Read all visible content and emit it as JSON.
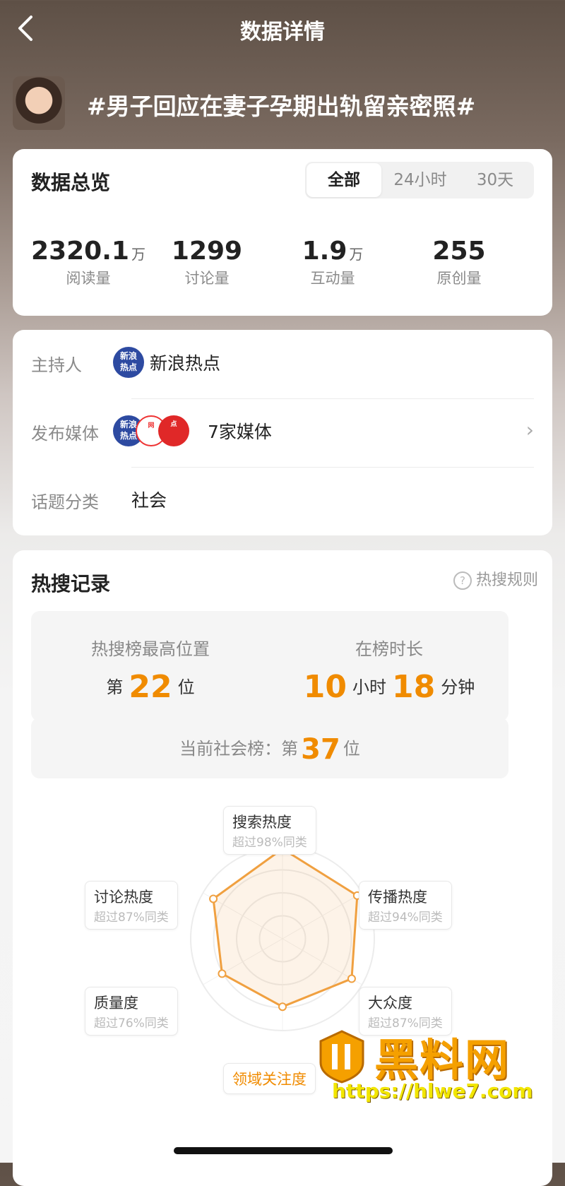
{
  "header": {
    "back_icon": "chevron-left-icon",
    "title": "数据详情"
  },
  "topic": {
    "text": "#男子回应在妻子孕期出轨留亲密照#"
  },
  "overview": {
    "title": "数据总览",
    "tabs": [
      "全部",
      "24小时",
      "30天"
    ],
    "selected_tab": "全部",
    "stats": [
      {
        "value": "2320.1",
        "unit": "万",
        "label": "阅读量"
      },
      {
        "value": "1299",
        "unit": "",
        "label": "讨论量"
      },
      {
        "value": "1.9",
        "unit": "万",
        "label": "互动量"
      },
      {
        "value": "255",
        "unit": "",
        "label": "原创量"
      }
    ]
  },
  "info": {
    "host_label": "主持人",
    "host_value": "新浪热点",
    "media_label": "发布媒体",
    "media_value": "7家媒体",
    "category_label": "话题分类",
    "category_value": "社会",
    "logo_sina_text": "新浪热点"
  },
  "hot_search": {
    "title": "热搜记录",
    "rules_label": "热搜规则",
    "best_pos_label": "热搜榜最高位置",
    "best_pos_prefix": "第",
    "best_pos_value": "22",
    "best_pos_suffix": "位",
    "duration_label": "在榜时长",
    "hours": "10",
    "hours_unit": "小时",
    "minutes": "18",
    "minutes_unit": "分钟",
    "current_prefix": "当前社会榜：第",
    "current_value": "37",
    "current_suffix": "位"
  },
  "radar": {
    "dimensions": [
      {
        "name": "搜索热度",
        "sub": "超过98%同类",
        "pct": 98
      },
      {
        "name": "传播热度",
        "sub": "超过94%同类",
        "pct": 94
      },
      {
        "name": "大众度",
        "sub": "超过87%同类",
        "pct": 87
      },
      {
        "name": "领域关注度",
        "sub": "",
        "pct": 74
      },
      {
        "name": "质量度",
        "sub": "超过76%同类",
        "pct": 76
      },
      {
        "name": "讨论热度",
        "sub": "超过87%同类",
        "pct": 87
      }
    ],
    "color": "#f0a040"
  },
  "watermark": {
    "text": "黑料网",
    "url": "https://hlwe7.com"
  },
  "colors": {
    "accent": "#f08b00"
  }
}
